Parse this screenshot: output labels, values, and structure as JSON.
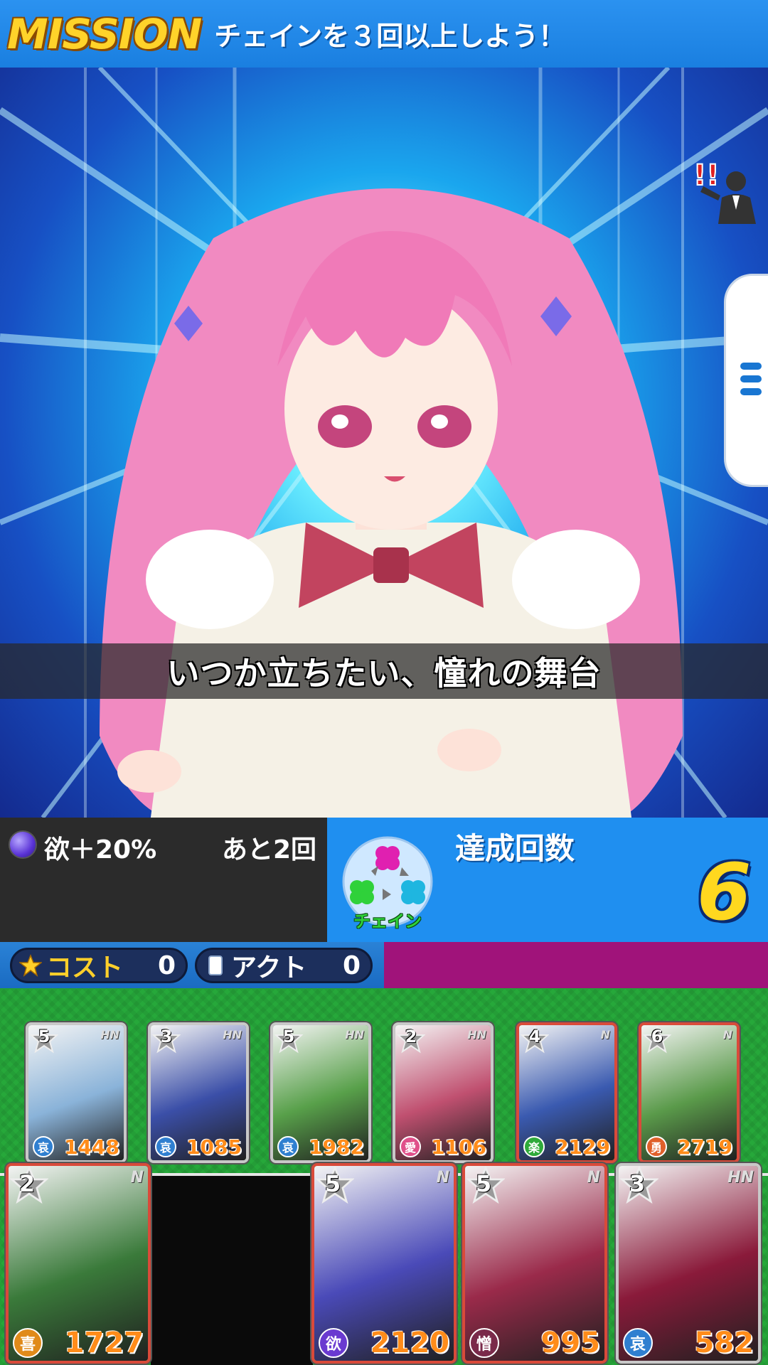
{
  "mission": {
    "logo": "MISSION",
    "text": "チェインを３回以上しよう！"
  },
  "scene": {
    "subtitle": "いつか立ちたい、憧れの舞台"
  },
  "status": {
    "bonus": "欲＋20%",
    "remaining": "あと2回",
    "chain_label": "チェイン",
    "achieve_title": "達成回数",
    "achieve_count": "6"
  },
  "resources": {
    "cost_label": "コスト",
    "cost_value": "0",
    "act_label": "アクト",
    "act_value": "0"
  },
  "field_cards": [
    {
      "cost": "5",
      "rarity": "HN",
      "attr": "哀",
      "power": "1448",
      "attr_color": "#2f7fd0",
      "theme": "#8ab3d9"
    },
    {
      "cost": "3",
      "rarity": "HN",
      "attr": "哀",
      "power": "1085",
      "attr_color": "#2f7fd0",
      "theme": "#3b4fa8"
    },
    {
      "cost": "5",
      "rarity": "HN",
      "attr": "哀",
      "power": "1982",
      "attr_color": "#2f7fd0",
      "theme": "#58a04a"
    },
    {
      "cost": "2",
      "rarity": "HN",
      "attr": "愛",
      "power": "1106",
      "attr_color": "#e0508a",
      "theme": "#c05070"
    },
    {
      "cost": "4",
      "rarity": "N",
      "attr": "楽",
      "power": "2129",
      "attr_color": "#2faa3a",
      "theme": "#3a5ab0"
    },
    {
      "cost": "6",
      "rarity": "N",
      "attr": "勇",
      "power": "2719",
      "attr_color": "#e0602a",
      "theme": "#5a9a4a"
    }
  ],
  "hand_cards": [
    {
      "cost": "2",
      "rarity": "N",
      "attr": "喜",
      "power": "1727",
      "attr_color": "#e08a1a",
      "theme": "#3a7a3a"
    },
    {
      "cost": "5",
      "rarity": "N",
      "attr": "欲",
      "power": "2120",
      "attr_color": "#6a3ad0",
      "theme": "#4a4ab8"
    },
    {
      "cost": "5",
      "rarity": "N",
      "attr": "憎",
      "power": "995",
      "attr_color": "#7a2a4a",
      "theme": "#9a2a4a"
    },
    {
      "cost": "3",
      "rarity": "HN",
      "attr": "哀",
      "power": "582",
      "attr_color": "#2f7fd0",
      "theme": "#8a1a3a"
    }
  ],
  "icons": {
    "alert": "manager-alert-icon",
    "menu": "menu-icon",
    "orb": "desire-orb-icon",
    "chain": "chain-clover-icon",
    "star": "star-icon",
    "card": "act-card-icon"
  },
  "colors": {
    "mission_bar": "#1f8ff0",
    "field_green": "#26a83a",
    "magenta_bar": "#a0137a",
    "count_yellow": "#ffd81f"
  }
}
